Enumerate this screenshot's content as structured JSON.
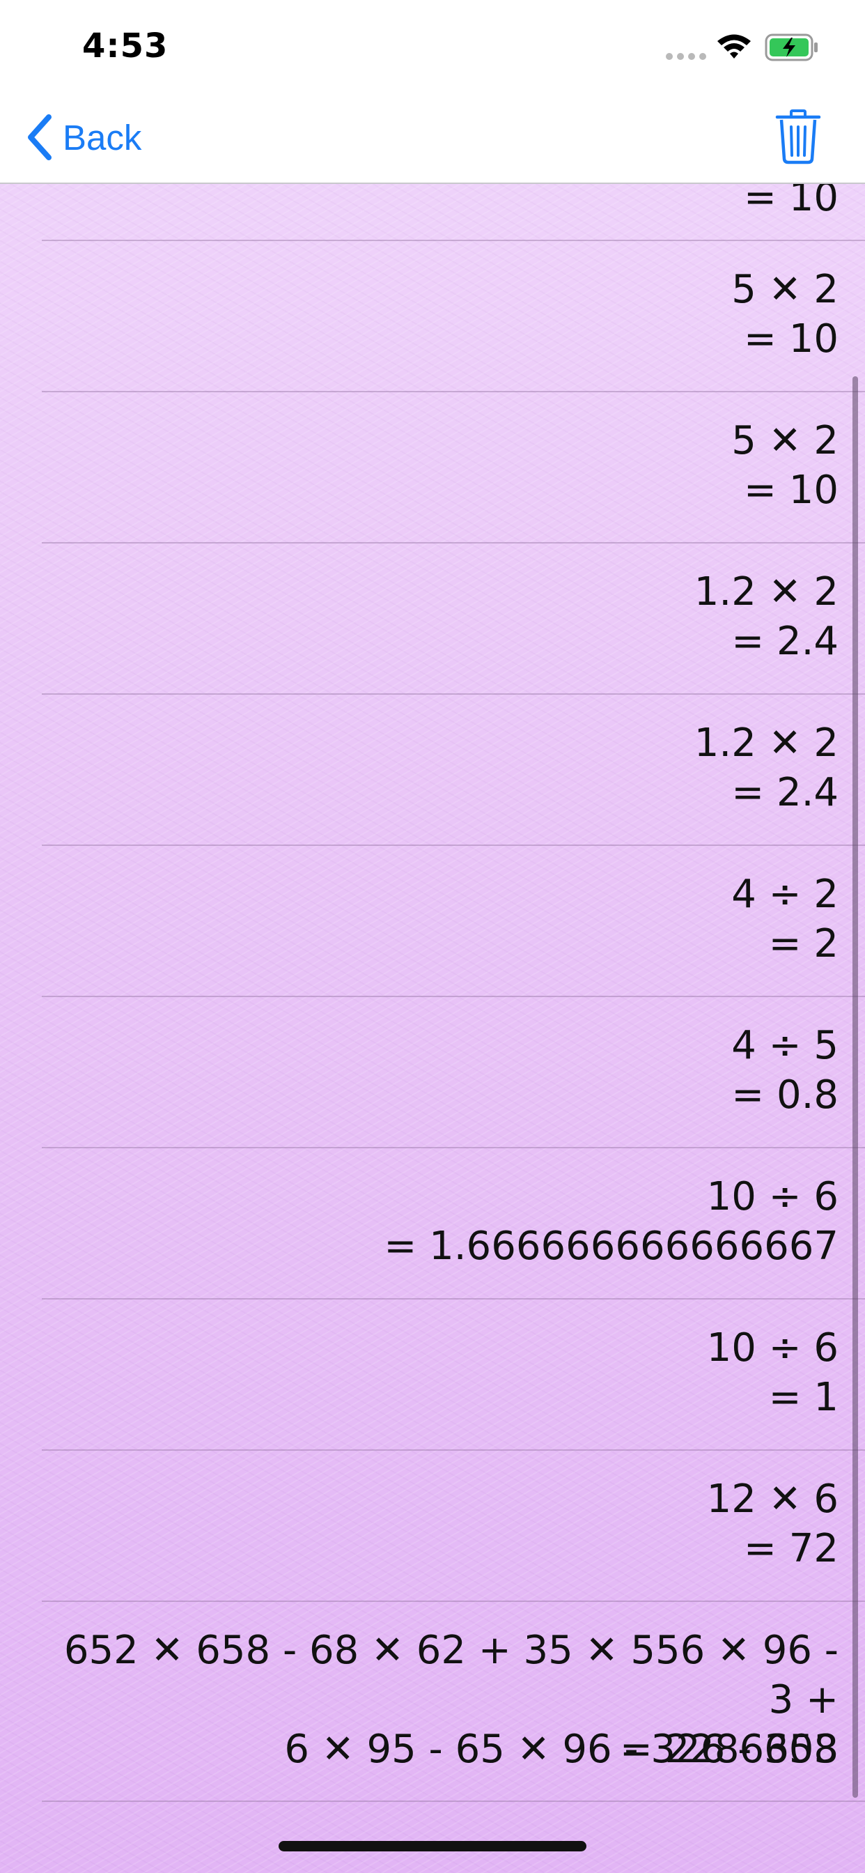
{
  "status_bar": {
    "time": "4:53"
  },
  "nav": {
    "back_label": "Back",
    "back_icon": "chevron-left-icon",
    "trash_icon": "trash-icon",
    "accent_color": "#1a7cf5"
  },
  "history": {
    "partial_row": {
      "result": "= 10"
    },
    "rows": [
      {
        "expression": "5 ✕ 2",
        "result": "= 10"
      },
      {
        "expression": "5 ✕ 2",
        "result": "= 10"
      },
      {
        "expression": "1.2 ✕ 2",
        "result": "= 2.4"
      },
      {
        "expression": "1.2 ✕ 2",
        "result": "= 2.4"
      },
      {
        "expression": "4 ÷ 2",
        "result": "= 2"
      },
      {
        "expression": "4 ÷ 5",
        "result": "= 0.8"
      },
      {
        "expression": "10 ÷ 6",
        "result": "= 1.666666666666667"
      },
      {
        "expression": "10 ÷ 6",
        "result": "= 1"
      },
      {
        "expression": "12 ✕ 6",
        "result": "= 72"
      },
      {
        "expression": "652 ✕ 658 - 68 ✕ 62 + 35 ✕ 556 ✕ 96 - 3 +\n6 ✕ 95 - 65 ✕ 96 - 326 - 653",
        "result": "= 2286308"
      }
    ]
  }
}
